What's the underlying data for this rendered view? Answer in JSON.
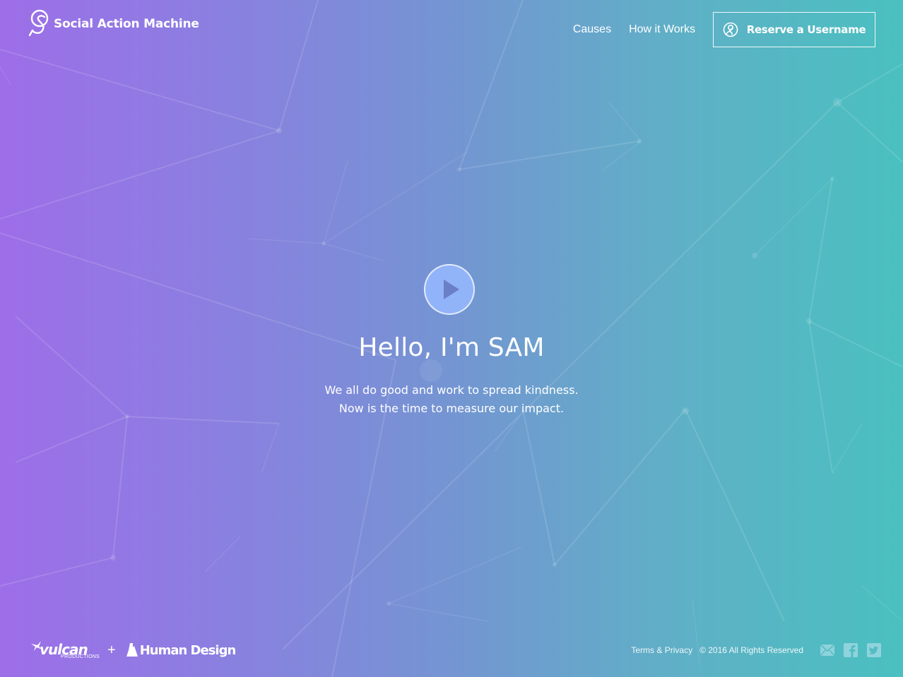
{
  "header": {
    "logo_text": "Social Action Machine",
    "nav": {
      "causes": "Causes",
      "how_it_works": "How it Works",
      "reserve": "Reserve a Username"
    }
  },
  "hero": {
    "title": "Hello, I'm SAM",
    "subtitle_line1": "We all do good and work to spread kindness.",
    "subtitle_line2": "Now is the time to measure our impact."
  },
  "footer": {
    "partner1_name": "vulcan",
    "partner1_sub": "PRODUCTIONS",
    "plus": "+",
    "partner2_name": "Human Design",
    "terms": "Terms & Privacy",
    "copyright": "© 2016 All Rights Reserved",
    "social_icons": [
      "mail-icon",
      "facebook-icon",
      "twitter-icon"
    ]
  },
  "colors": {
    "gradient_start": "#9d6ee8",
    "gradient_end": "#4ac0c0",
    "play_fill": "#96b9ff",
    "icon_muted": "#8fd3dc"
  }
}
